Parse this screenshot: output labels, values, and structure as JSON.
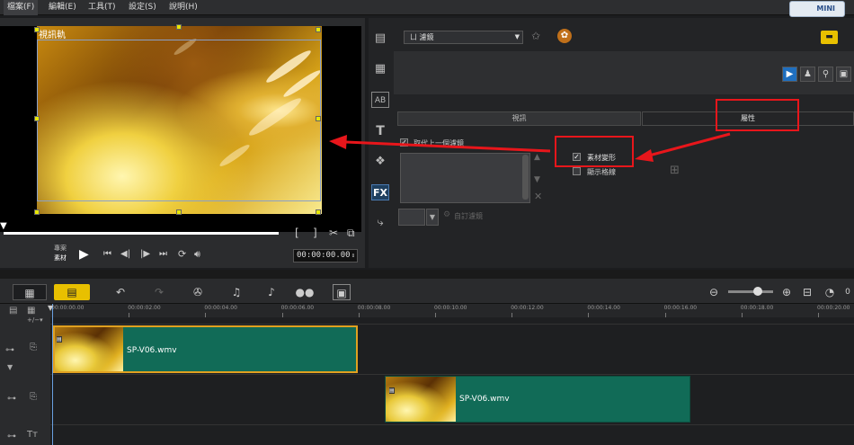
{
  "menu": [
    "檔案(F)",
    "編輯(E)",
    "工具(T)",
    "設定(S)",
    "說明(H)"
  ],
  "mini_label": "MINI",
  "preview": {
    "label": "視訊軌",
    "mode_project": "專案",
    "mode_clip": "素材",
    "timecode": "00:00:00.00"
  },
  "options": {
    "filter_dropdown": "ㄩ 濾鏡",
    "tab_video": "視訊",
    "tab_attributes": "屬性",
    "replace_last_filter": "取代上一個濾鏡",
    "custom_filter": "自訂濾鏡",
    "distort_clip": "素材變形",
    "show_grid": "顯示格線",
    "fx": "FX",
    "ab": "AB",
    "t": "T"
  },
  "ruler_ticks": [
    "00:00:00.00",
    "00:00:02.00",
    "00:00:04.00",
    "00:00:06.00",
    "00:00:08.00",
    "00:00:10.00",
    "00:00:12.00",
    "00:00:14.00",
    "00:00:16.00",
    "00:00:18.00",
    "00:00:20.00"
  ],
  "clips": [
    {
      "name": "SP-V06.wmv"
    },
    {
      "name": "SP-V06.wmv"
    }
  ],
  "toolbar": {
    "zero": "0"
  },
  "annotation_color": "#e8161b"
}
